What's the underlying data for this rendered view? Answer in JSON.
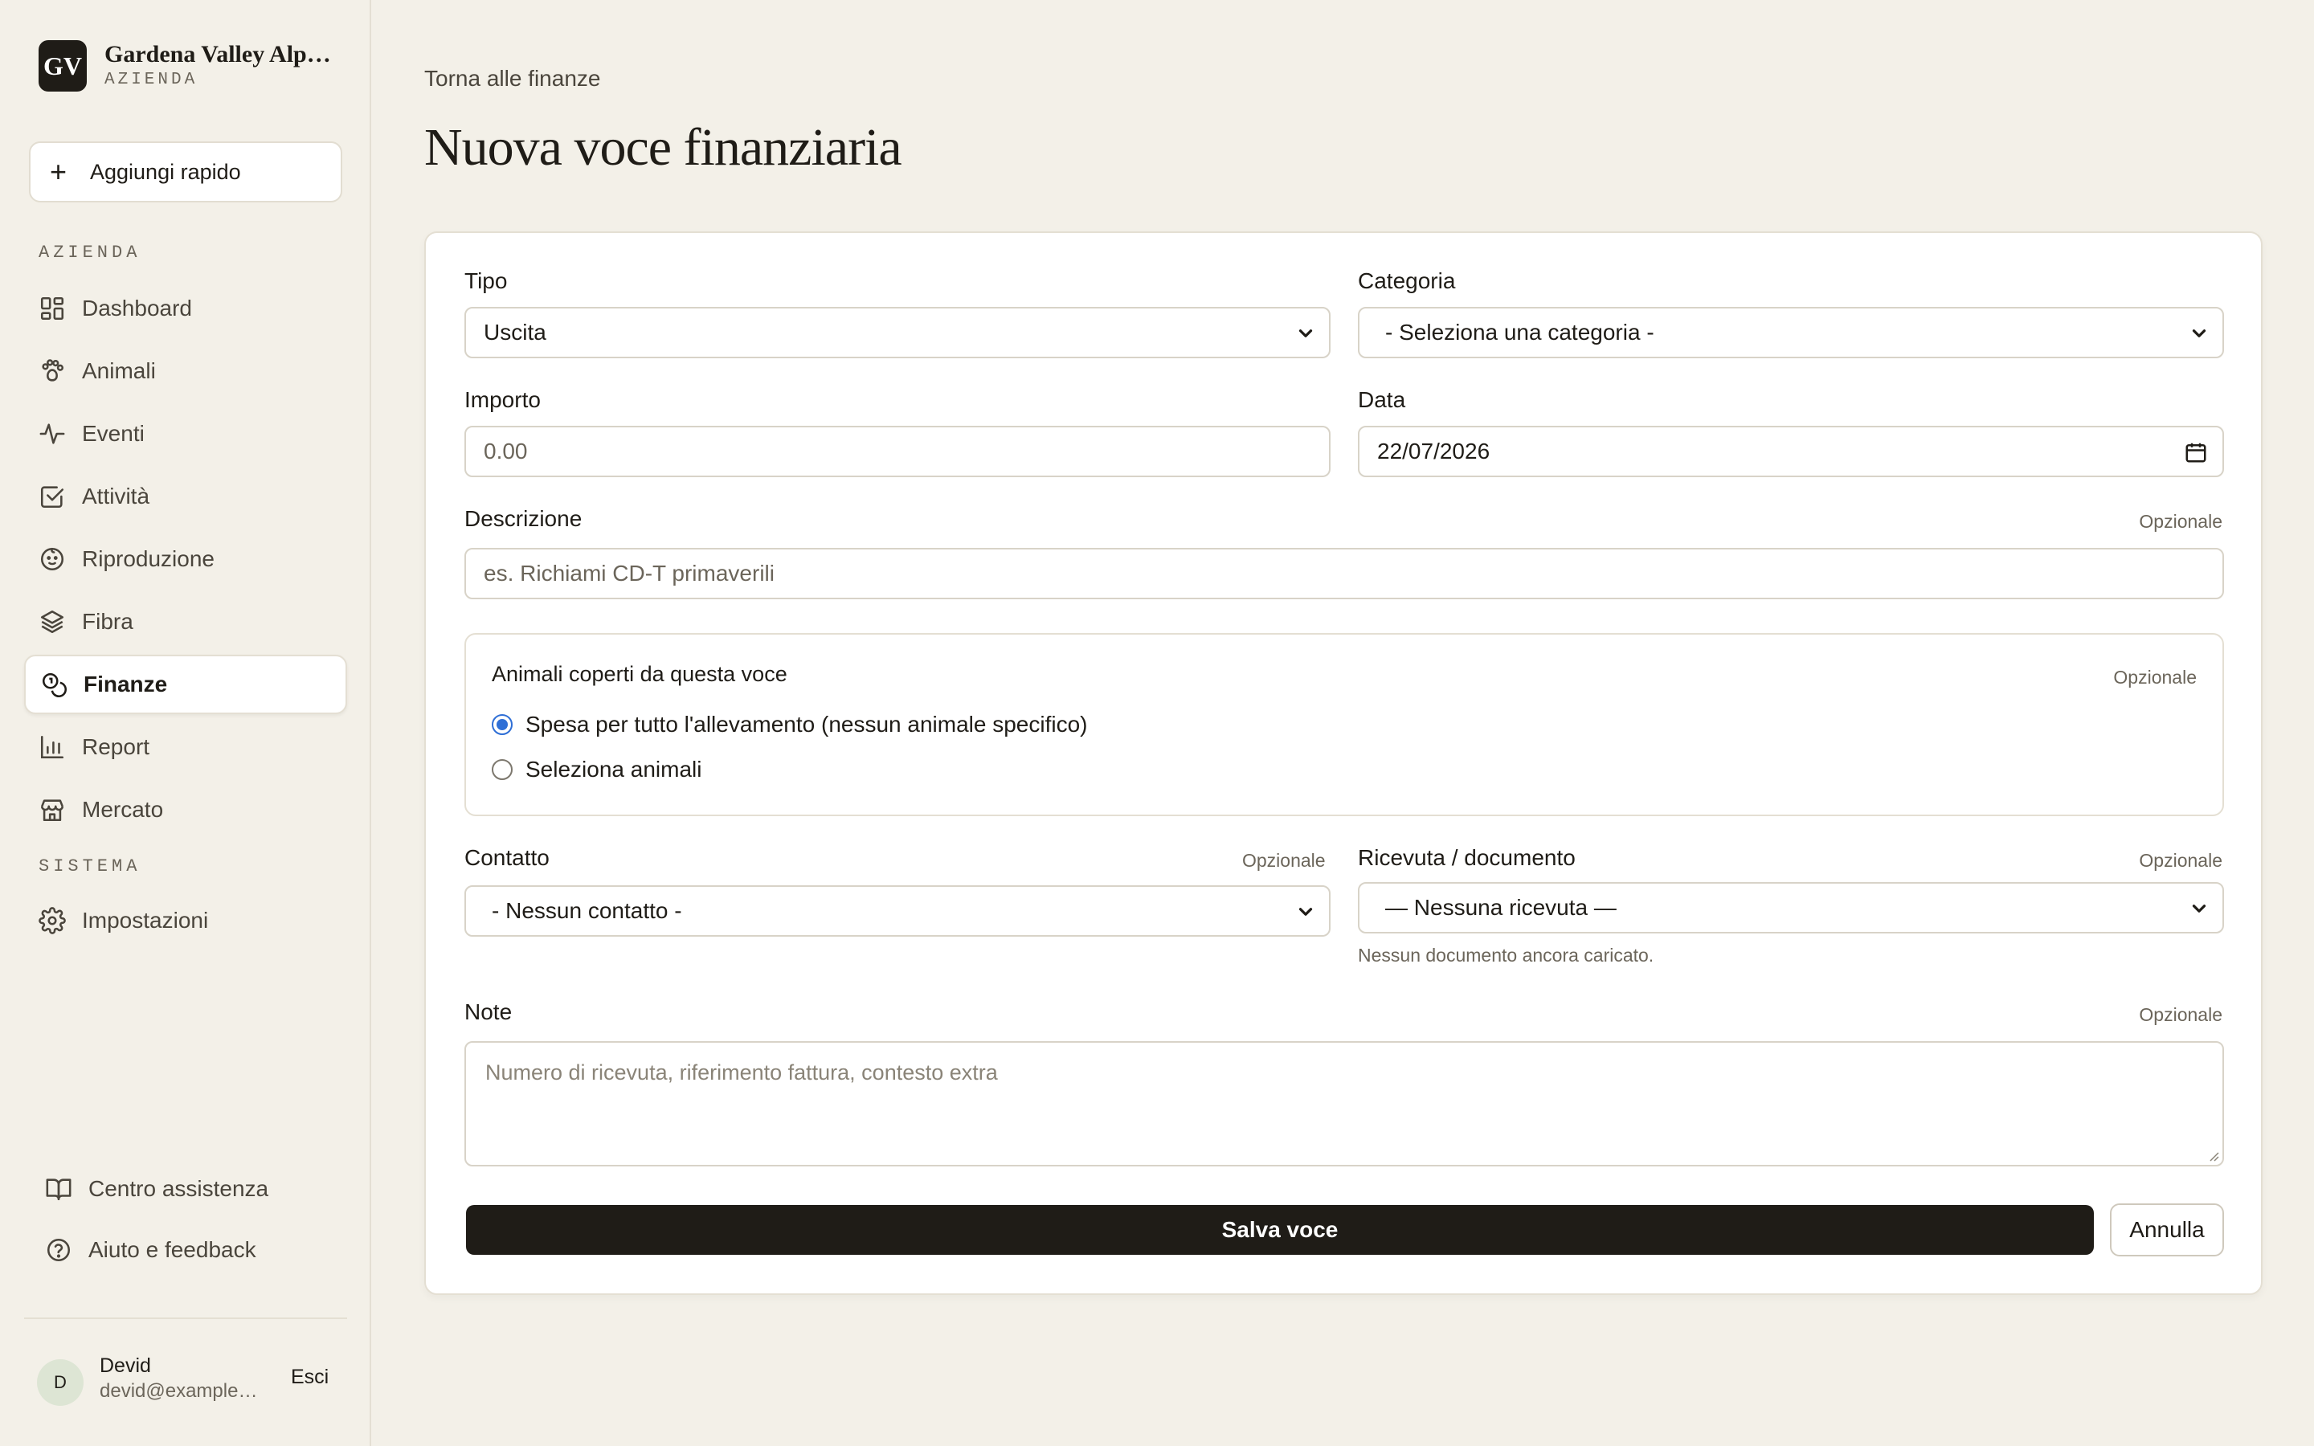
{
  "brand": {
    "logo": "GV",
    "name": "Gardena Valley Alp…",
    "subtitle": "AZIENDA"
  },
  "sidebar": {
    "quick_add_label": "Aggiungi rapido",
    "section_farm": "AZIENDA",
    "section_system": "SISTEMA",
    "items": [
      {
        "label": "Dashboard",
        "icon": "grid-icon"
      },
      {
        "label": "Animali",
        "icon": "paw-icon"
      },
      {
        "label": "Eventi",
        "icon": "activity-icon"
      },
      {
        "label": "Attività",
        "icon": "checkbox-icon"
      },
      {
        "label": "Riproduzione",
        "icon": "baby-icon"
      },
      {
        "label": "Fibra",
        "icon": "layers-icon"
      },
      {
        "label": "Finanze",
        "icon": "coins-icon",
        "active": true
      },
      {
        "label": "Report",
        "icon": "bar-chart-icon"
      },
      {
        "label": "Mercato",
        "icon": "store-icon"
      }
    ],
    "system_items": [
      {
        "label": "Impostazioni",
        "icon": "gear-icon"
      }
    ],
    "help_center": "Centro assistenza",
    "help_feedback": "Aiuto e feedback"
  },
  "user": {
    "initial": "D",
    "name": "Devid",
    "email": "devid@example…",
    "logout": "Esci"
  },
  "page": {
    "back_link": "Torna alle finanze",
    "title": "Nuova voce finanziaria"
  },
  "form": {
    "type_label": "Tipo",
    "type_value": "Uscita",
    "category_label": "Categoria",
    "category_value": "- Seleziona una categoria -",
    "amount_label": "Importo",
    "amount_placeholder": "0.00",
    "date_label": "Data",
    "date_value": "22/07/2026",
    "description_label": "Descrizione",
    "description_placeholder": "es. Richiami CD-T primaverili",
    "optional": "Opzionale",
    "animals_title": "Animali coperti da questa voce",
    "animals_options": [
      "Spesa per tutto l'allevamento (nessun animale specifico)",
      "Seleziona animali"
    ],
    "animals_selected": 0,
    "contact_label": "Contatto",
    "contact_value": "- Nessun contatto -",
    "receipt_label": "Ricevuta / documento",
    "receipt_value": "— Nessuna ricevuta —",
    "receipt_helper": "Nessun documento ancora caricato.",
    "notes_label": "Note",
    "notes_placeholder": "Numero di ricevuta, riferimento fattura, contesto extra",
    "save_label": "Salva voce",
    "cancel_label": "Annulla"
  },
  "colors": {
    "background": "#f3f0e8",
    "primary": "#1f1c17",
    "radio_accent": "#2f6fd6"
  }
}
